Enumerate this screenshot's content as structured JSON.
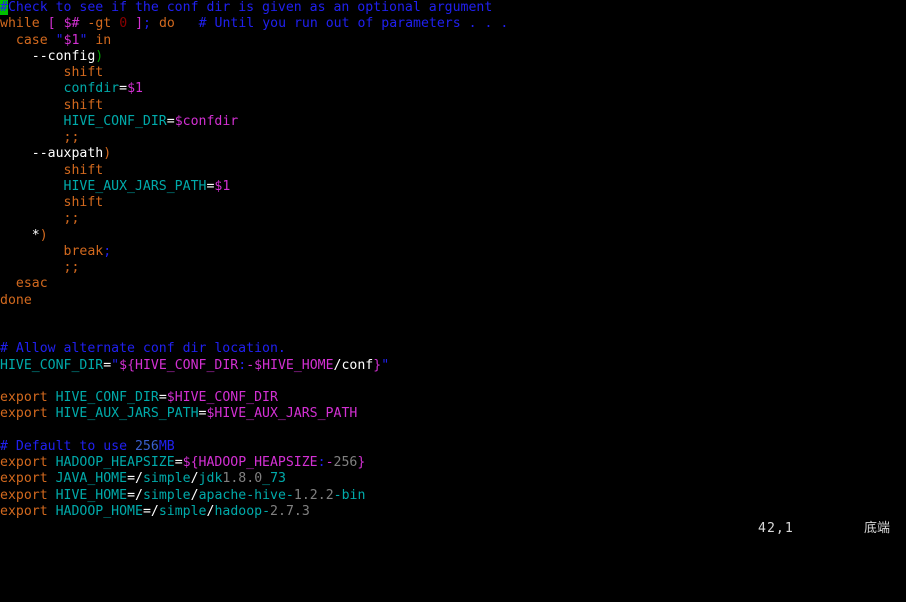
{
  "editor": {
    "app": "vim",
    "background": "#000000",
    "foreground": "#c0c0c0",
    "cursor_color": "#00c000"
  },
  "status": {
    "cursor_position": "42,1",
    "location_label": "底端"
  },
  "lines": [
    {
      "n": 1,
      "text": "#Check to see if the conf dir is given as an optional argument"
    },
    {
      "n": 2,
      "text": "while [ $# -gt 0 ]; do   # Until you run out of parameters . . ."
    },
    {
      "n": 3,
      "text": "  case \"$1\" in"
    },
    {
      "n": 4,
      "text": "    --config)"
    },
    {
      "n": 5,
      "text": "        shift"
    },
    {
      "n": 6,
      "text": "        confdir=$1"
    },
    {
      "n": 7,
      "text": "        shift"
    },
    {
      "n": 8,
      "text": "        HIVE_CONF_DIR=$confdir"
    },
    {
      "n": 9,
      "text": "        ;;"
    },
    {
      "n": 10,
      "text": "    --auxpath)"
    },
    {
      "n": 11,
      "text": "        shift"
    },
    {
      "n": 12,
      "text": "        HIVE_AUX_JARS_PATH=$1"
    },
    {
      "n": 13,
      "text": "        shift"
    },
    {
      "n": 14,
      "text": "        ;;"
    },
    {
      "n": 15,
      "text": "    *)"
    },
    {
      "n": 16,
      "text": "        break;"
    },
    {
      "n": 17,
      "text": "        ;;"
    },
    {
      "n": 18,
      "text": "  esac"
    },
    {
      "n": 19,
      "text": "done"
    },
    {
      "n": 20,
      "text": ""
    },
    {
      "n": 21,
      "text": ""
    },
    {
      "n": 22,
      "text": "# Allow alternate conf dir location."
    },
    {
      "n": 23,
      "text": "HIVE_CONF_DIR=\"${HIVE_CONF_DIR:-$HIVE_HOME/conf}\""
    },
    {
      "n": 24,
      "text": ""
    },
    {
      "n": 25,
      "text": "export HIVE_CONF_DIR=$HIVE_CONF_DIR"
    },
    {
      "n": 26,
      "text": "export HIVE_AUX_JARS_PATH=$HIVE_AUX_JARS_PATH"
    },
    {
      "n": 27,
      "text": ""
    },
    {
      "n": 28,
      "text": "# Default to use 256MB"
    },
    {
      "n": 29,
      "text": "export HADOOP_HEAPSIZE=${HADOOP_HEAPSIZE:-256}"
    },
    {
      "n": 30,
      "text": "export JAVA_HOME=/simple/jdk1.8.0_73"
    },
    {
      "n": 31,
      "text": "export HIVE_HOME=/simple/apache-hive-1.2.2-bin"
    },
    {
      "n": 32,
      "text": "export HADOOP_HOME=/simple/hadoop-2.7.3"
    }
  ],
  "tokens": {
    "l1": [
      {
        "t": "#",
        "c": "cursor"
      },
      {
        "t": "Check to see if the conf dir is given as an optional argument",
        "c": "c-comment"
      }
    ],
    "l2": [
      {
        "t": "while",
        "c": "c-keyword"
      },
      {
        "t": " ",
        "c": "c-plain"
      },
      {
        "t": "[",
        "c": "c-brack"
      },
      {
        "t": " ",
        "c": "c-plain"
      },
      {
        "t": "$#",
        "c": "c-dollar"
      },
      {
        "t": " ",
        "c": "c-plain"
      },
      {
        "t": "-gt",
        "c": "c-keyword"
      },
      {
        "t": " ",
        "c": "c-plain"
      },
      {
        "t": "0",
        "c": "c-num"
      },
      {
        "t": " ",
        "c": "c-plain"
      },
      {
        "t": "]",
        "c": "c-brack"
      },
      {
        "t": ";",
        "c": "c-punct"
      },
      {
        "t": " ",
        "c": "c-plain"
      },
      {
        "t": "do",
        "c": "c-keyword"
      },
      {
        "t": "   ",
        "c": "c-plain"
      },
      {
        "t": "# Until you run out of parameters . . .",
        "c": "c-comment"
      }
    ],
    "l3": [
      {
        "t": "  ",
        "c": "c-plain"
      },
      {
        "t": "case",
        "c": "c-keyword"
      },
      {
        "t": " ",
        "c": "c-plain"
      },
      {
        "t": "\"",
        "c": "c-str"
      },
      {
        "t": "$1",
        "c": "c-dollar"
      },
      {
        "t": "\"",
        "c": "c-str"
      },
      {
        "t": " ",
        "c": "c-plain"
      },
      {
        "t": "in",
        "c": "c-keyword"
      }
    ],
    "l4": [
      {
        "t": "    --config",
        "c": "c-plain"
      },
      {
        "t": ")",
        "c": "c-parengrn"
      }
    ],
    "l5": [
      {
        "t": "        ",
        "c": "c-plain"
      },
      {
        "t": "shift",
        "c": "c-keyword"
      }
    ],
    "l6": [
      {
        "t": "        ",
        "c": "c-plain"
      },
      {
        "t": "confdir",
        "c": "c-var"
      },
      {
        "t": "=",
        "c": "c-eq"
      },
      {
        "t": "$1",
        "c": "c-dollar"
      }
    ],
    "l7": [
      {
        "t": "        ",
        "c": "c-plain"
      },
      {
        "t": "shift",
        "c": "c-keyword"
      }
    ],
    "l8": [
      {
        "t": "        ",
        "c": "c-plain"
      },
      {
        "t": "HIVE_CONF_DIR",
        "c": "c-var"
      },
      {
        "t": "=",
        "c": "c-eq"
      },
      {
        "t": "$confdir",
        "c": "c-dollar"
      }
    ],
    "l9": [
      {
        "t": "        ",
        "c": "c-plain"
      },
      {
        "t": ";;",
        "c": "c-keyword"
      }
    ],
    "l10": [
      {
        "t": "    --auxpath",
        "c": "c-plain"
      },
      {
        "t": ")",
        "c": "c-paren"
      }
    ],
    "l11": [
      {
        "t": "        ",
        "c": "c-plain"
      },
      {
        "t": "shift",
        "c": "c-keyword"
      }
    ],
    "l12": [
      {
        "t": "        ",
        "c": "c-plain"
      },
      {
        "t": "HIVE_AUX_JARS_PATH",
        "c": "c-var"
      },
      {
        "t": "=",
        "c": "c-eq"
      },
      {
        "t": "$1",
        "c": "c-dollar"
      }
    ],
    "l13": [
      {
        "t": "        ",
        "c": "c-plain"
      },
      {
        "t": "shift",
        "c": "c-keyword"
      }
    ],
    "l14": [
      {
        "t": "        ",
        "c": "c-plain"
      },
      {
        "t": ";;",
        "c": "c-keyword"
      }
    ],
    "l15": [
      {
        "t": "    *",
        "c": "c-plain"
      },
      {
        "t": ")",
        "c": "c-paren"
      }
    ],
    "l16": [
      {
        "t": "        ",
        "c": "c-plain"
      },
      {
        "t": "break",
        "c": "c-keyword"
      },
      {
        "t": ";",
        "c": "c-punct"
      }
    ],
    "l17": [
      {
        "t": "        ",
        "c": "c-plain"
      },
      {
        "t": ";;",
        "c": "c-keyword"
      }
    ],
    "l18": [
      {
        "t": "  ",
        "c": "c-plain"
      },
      {
        "t": "esac",
        "c": "c-keyword"
      }
    ],
    "l19": [
      {
        "t": "done",
        "c": "c-keyword"
      }
    ],
    "l22": [
      {
        "t": "# Allow alternate conf dir location.",
        "c": "c-comment"
      }
    ],
    "l23": [
      {
        "t": "HIVE_CONF_DIR",
        "c": "c-var"
      },
      {
        "t": "=",
        "c": "c-eq"
      },
      {
        "t": "\"",
        "c": "c-str"
      },
      {
        "t": "${",
        "c": "c-brack"
      },
      {
        "t": "HIVE_CONF_DIR",
        "c": "c-dollar"
      },
      {
        "t": ":",
        "c": "c-str"
      },
      {
        "t": "-",
        "c": "c-dollar"
      },
      {
        "t": "$HIVE_HOME",
        "c": "c-dollar"
      },
      {
        "t": "/conf",
        "c": "c-plain"
      },
      {
        "t": "}",
        "c": "c-brack"
      },
      {
        "t": "\"",
        "c": "c-str"
      }
    ],
    "l25": [
      {
        "t": "export",
        "c": "c-keyword"
      },
      {
        "t": " ",
        "c": "c-plain"
      },
      {
        "t": "HIVE_CONF_DIR",
        "c": "c-var"
      },
      {
        "t": "=",
        "c": "c-eq"
      },
      {
        "t": "$HIVE_CONF_DIR",
        "c": "c-dollar"
      }
    ],
    "l26": [
      {
        "t": "export",
        "c": "c-keyword"
      },
      {
        "t": " ",
        "c": "c-plain"
      },
      {
        "t": "HIVE_AUX_JARS_PATH",
        "c": "c-var"
      },
      {
        "t": "=",
        "c": "c-eq"
      },
      {
        "t": "$HIVE_AUX_JARS_PATH",
        "c": "c-dollar"
      }
    ],
    "l28": [
      {
        "t": "# Default to use ",
        "c": "c-comment"
      },
      {
        "t": "256",
        "c": "c-commentnum"
      },
      {
        "t": "MB",
        "c": "c-comment"
      }
    ],
    "l29": [
      {
        "t": "export",
        "c": "c-keyword"
      },
      {
        "t": " ",
        "c": "c-plain"
      },
      {
        "t": "HADOOP_HEAPSIZE",
        "c": "c-var"
      },
      {
        "t": "=",
        "c": "c-eq"
      },
      {
        "t": "${",
        "c": "c-brack"
      },
      {
        "t": "HADOOP_HEAPSIZE",
        "c": "c-dollar"
      },
      {
        "t": ":",
        "c": "c-str"
      },
      {
        "t": "-",
        "c": "c-dollar"
      },
      {
        "t": "256",
        "c": "c-num2"
      },
      {
        "t": "}",
        "c": "c-brack"
      }
    ],
    "l30": [
      {
        "t": "export",
        "c": "c-keyword"
      },
      {
        "t": " ",
        "c": "c-plain"
      },
      {
        "t": "JAVA_HOME",
        "c": "c-var"
      },
      {
        "t": "=",
        "c": "c-eq"
      },
      {
        "t": "/",
        "c": "c-plain"
      },
      {
        "t": "simple",
        "c": "c-path"
      },
      {
        "t": "/",
        "c": "c-plain"
      },
      {
        "t": "jdk",
        "c": "c-path"
      },
      {
        "t": "1",
        "c": "c-num2"
      },
      {
        "t": ".",
        "c": "c-num2"
      },
      {
        "t": "8",
        "c": "c-num2"
      },
      {
        "t": ".",
        "c": "c-num2"
      },
      {
        "t": "0",
        "c": "c-num2"
      },
      {
        "t": "_73",
        "c": "c-path"
      }
    ],
    "l31": [
      {
        "t": "export",
        "c": "c-keyword"
      },
      {
        "t": " ",
        "c": "c-plain"
      },
      {
        "t": "HIVE_HOME",
        "c": "c-var"
      },
      {
        "t": "=",
        "c": "c-eq"
      },
      {
        "t": "/",
        "c": "c-plain"
      },
      {
        "t": "simple",
        "c": "c-path"
      },
      {
        "t": "/",
        "c": "c-plain"
      },
      {
        "t": "apache",
        "c": "c-path"
      },
      {
        "t": "-",
        "c": "c-path"
      },
      {
        "t": "hive",
        "c": "c-path"
      },
      {
        "t": "-",
        "c": "c-path"
      },
      {
        "t": "1",
        "c": "c-num2"
      },
      {
        "t": ".",
        "c": "c-num2"
      },
      {
        "t": "2",
        "c": "c-num2"
      },
      {
        "t": ".",
        "c": "c-num2"
      },
      {
        "t": "2",
        "c": "c-num2"
      },
      {
        "t": "-",
        "c": "c-path"
      },
      {
        "t": "bin",
        "c": "c-path"
      }
    ],
    "l32": [
      {
        "t": "export",
        "c": "c-keyword"
      },
      {
        "t": " ",
        "c": "c-plain"
      },
      {
        "t": "HADOOP_HOME",
        "c": "c-var"
      },
      {
        "t": "=",
        "c": "c-eq"
      },
      {
        "t": "/",
        "c": "c-plain"
      },
      {
        "t": "simple",
        "c": "c-path"
      },
      {
        "t": "/",
        "c": "c-plain"
      },
      {
        "t": "hadoop",
        "c": "c-path"
      },
      {
        "t": "-",
        "c": "c-path"
      },
      {
        "t": "2",
        "c": "c-num2"
      },
      {
        "t": ".",
        "c": "c-num2"
      },
      {
        "t": "7",
        "c": "c-num2"
      },
      {
        "t": ".",
        "c": "c-num2"
      },
      {
        "t": "3",
        "c": "c-num2"
      }
    ]
  }
}
